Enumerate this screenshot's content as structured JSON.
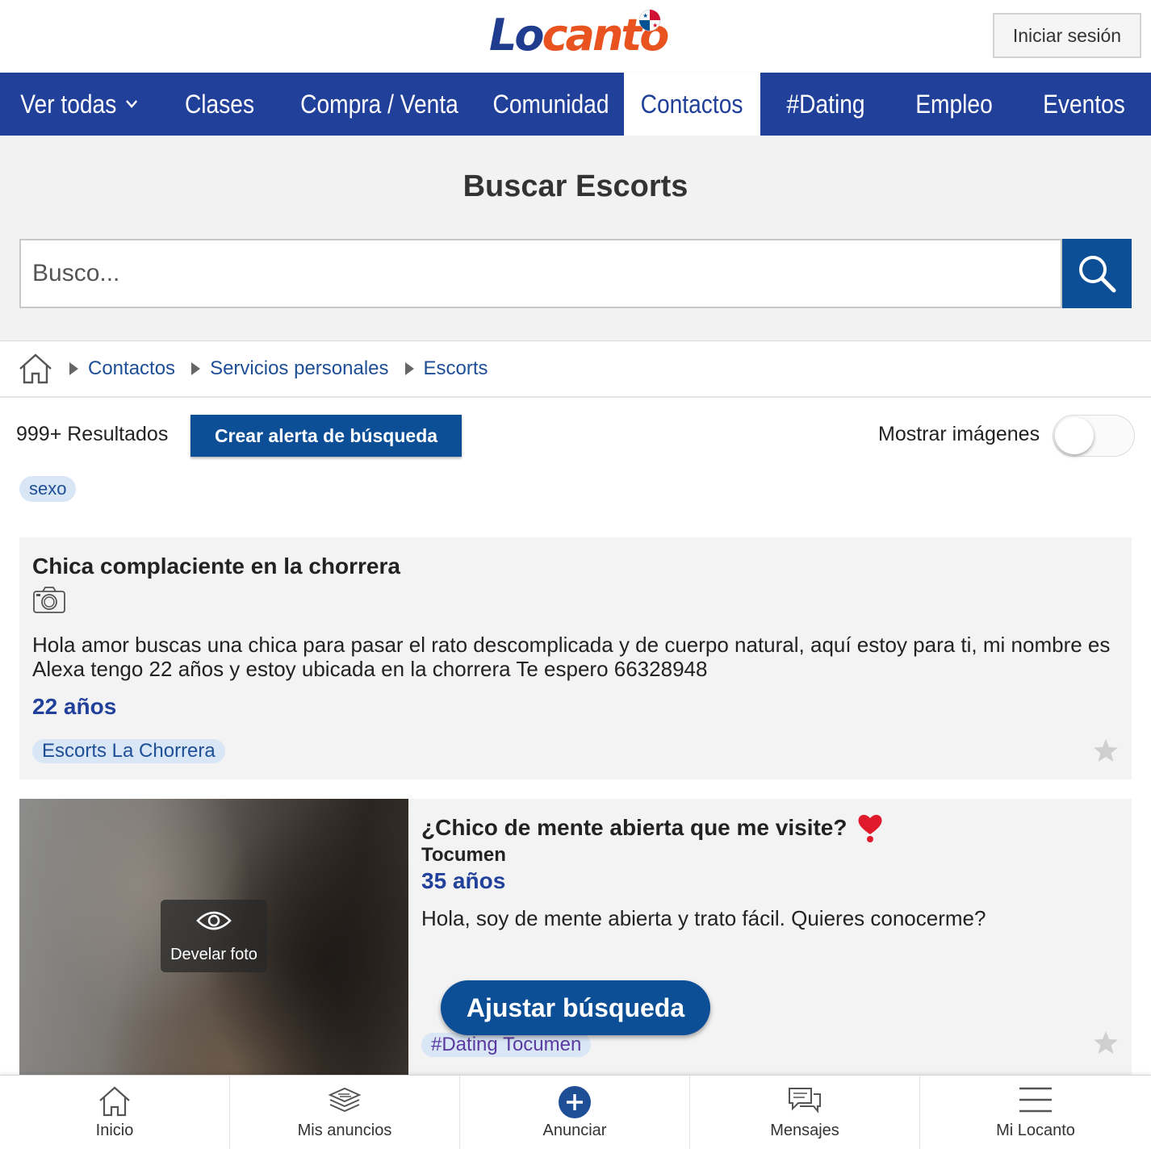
{
  "header": {
    "logo_text_part1": "Lo",
    "logo_text_part2": "canto",
    "login_label": "Iniciar sesión"
  },
  "nav": {
    "items": [
      {
        "label": "Ver todas"
      },
      {
        "label": "Clases"
      },
      {
        "label": "Compra / Venta"
      },
      {
        "label": "Comunidad"
      },
      {
        "label": "Contactos",
        "active": true
      },
      {
        "label": "#Dating"
      },
      {
        "label": "Empleo"
      },
      {
        "label": "Eventos"
      }
    ]
  },
  "search": {
    "title": "Buscar Escorts",
    "placeholder": "Busco..."
  },
  "breadcrumb": {
    "items": [
      "Contactos",
      "Servicios personales",
      "Escorts"
    ]
  },
  "results": {
    "count_label": "999+ Resultados",
    "alert_button": "Crear alerta de búsqueda",
    "show_images_label": "Mostrar imágenes",
    "show_images_on": false,
    "tag": "sexo"
  },
  "listings": [
    {
      "title": "Chica complaciente en la chorrera",
      "description": "Hola amor buscas una chica para pasar el rato descomplicada y de cuerpo natural, aquí estoy para ti, mi nombre es Alexa tengo 22 años y estoy ubicada en la chorrera Te espero 66328948",
      "age": "22 años",
      "tag": "Escorts La Chorrera"
    },
    {
      "title": "¿Chico de mente abierta que me visite?",
      "location": "Tocumen",
      "age": "35 años",
      "description": "Hola, soy de mente abierta y trato fácil. Quieres conocerme?",
      "tag": "#Dating Tocumen",
      "reveal_label": "Develar foto"
    }
  ],
  "adjust_button": "Ajustar búsqueda",
  "tabbar": {
    "items": [
      {
        "label": "Inicio",
        "icon": "home-icon"
      },
      {
        "label": "Mis anuncios",
        "icon": "layers-icon"
      },
      {
        "label": "Anunciar",
        "icon": "plus-circle-icon"
      },
      {
        "label": "Mensajes",
        "icon": "chat-icon"
      },
      {
        "label": "Mi Locanto",
        "icon": "menu-icon"
      }
    ]
  },
  "colors": {
    "nav_blue": "#21409a",
    "button_blue": "#0d4f96",
    "logo_orange": "#e8531f"
  }
}
